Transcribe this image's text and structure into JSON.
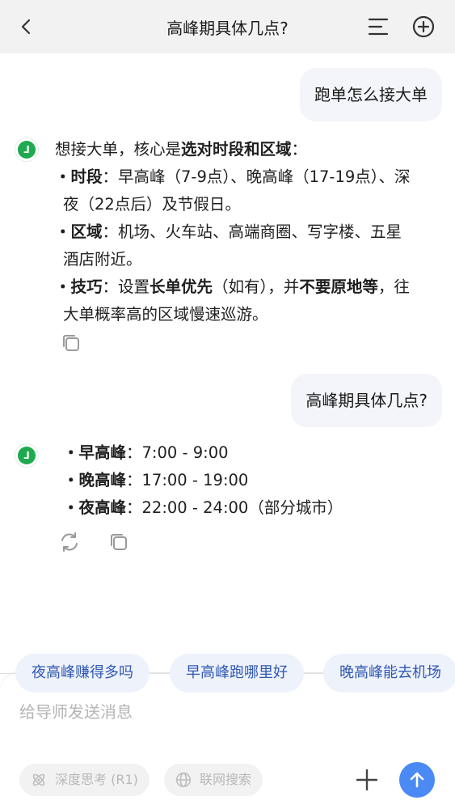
{
  "header": {
    "title": "高峰期具体几点?"
  },
  "messages": {
    "user1": "跑单怎么接大单",
    "ai1": {
      "intro": "想接大单，核心是",
      "intro_bold": "选对时段和区域",
      "intro_end": "：",
      "b1_label": "・时段",
      "b1_text": "：早高峰（7-9点）、晚高峰（17-19点）、深夜（22点后）及节假日。",
      "b2_label": "・区域",
      "b2_text": "：机场、火车站、高端商圈、写字楼、五星酒店附近。",
      "b3_label": "・技巧",
      "b3_pre": "：设置",
      "b3_bold1": "长单优先",
      "b3_mid": "（如有），并",
      "b3_bold2": "不要原地等",
      "b3_end": "，往大单概率高的区域慢速巡游。"
    },
    "user2": "高峰期具体几点?",
    "ai2": {
      "r1_label": "・早高峰",
      "r1_text": "：7:00 - 9:00",
      "r2_label": "・晚高峰",
      "r2_text": "：17:00 - 19:00",
      "r3_label": "・夜高峰",
      "r3_text": "：22:00 - 24:00（部分城市）"
    }
  },
  "suggestions": [
    "夜高峰赚得多吗",
    "早高峰跑哪里好",
    "晚高峰能去机场"
  ],
  "composer": {
    "placeholder": "给导师发送消息",
    "deep_think": "深度思考 (R1)",
    "web_search": "联网搜索"
  }
}
